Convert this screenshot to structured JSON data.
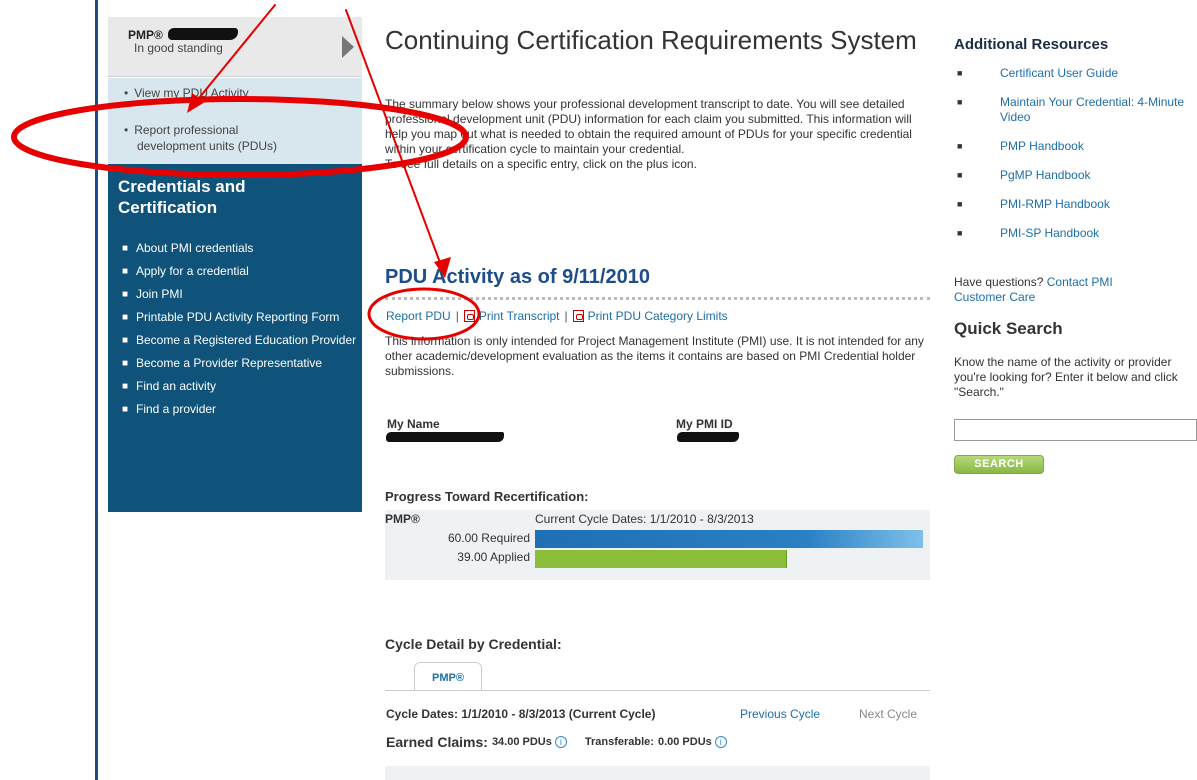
{
  "sidebar": {
    "credential": "PMP®",
    "status": "In good standing",
    "links": [
      {
        "label": "View my PDU Activity"
      },
      {
        "label_line1": "Report professional",
        "label_line2": "development units (PDUs)"
      }
    ],
    "section_title": "Credentials and Certification",
    "items": [
      {
        "label": "About PMI credentials"
      },
      {
        "label": "Apply for a credential"
      },
      {
        "label": "Join PMI"
      },
      {
        "label": "Printable PDU Activity Reporting Form"
      },
      {
        "label": "Become a Registered Education Provider"
      },
      {
        "label": "Become a Provider Representative"
      },
      {
        "label": "Find an activity"
      },
      {
        "label": "Find a provider"
      }
    ]
  },
  "main": {
    "title": "Continuing Certification Requirements System",
    "intro": "The summary below shows your professional development transcript to date. You will see detailed professional development unit (PDU) information for each claim you submitted. This information will help you map out what is needed to obtain the required amount of PDUs for your specific credential within your certification cycle to maintain your credential.",
    "intro_2": "To see full details on a specific entry, click on the plus icon.",
    "pdu_heading": "PDU Activity as of 9/11/2010",
    "actions": {
      "report": "Report PDU",
      "print_transcript": "Print Transcript",
      "print_limits": "Print PDU Category Limits",
      "separator": "|"
    },
    "note": "This information is only intended for Project Management Institute (PMI) use. It is not intended for any other academic/development evaluation as the items it contains are based on PMI Credential holder submissions.",
    "my_name_label": "My Name",
    "my_id_label": "My PMI ID",
    "progress": {
      "title": "Progress Toward Recertification:",
      "credential": "PMP®",
      "cycle_dates": "Current Cycle Dates: 1/1/2010 - 8/3/2013",
      "required_label": "60.00 Required",
      "applied_label": "39.00 Applied",
      "required_value": 60,
      "applied_value": 39,
      "max_value": 60
    },
    "cycle": {
      "title": "Cycle Detail by Credential:",
      "tab": "PMP®",
      "dates": "Cycle Dates: 1/1/2010 - 8/3/2013 (Current Cycle)",
      "previous": "Previous Cycle",
      "next": "Next Cycle",
      "earned_label": "Earned Claims:",
      "earned_value": "34.00 PDUs",
      "transferable_label": "Transferable:",
      "transferable_value": "0.00 PDUs",
      "info_glyph": "i"
    }
  },
  "right": {
    "heading": "Additional Resources",
    "bullet": "■",
    "resources": [
      {
        "label": "Certificant User Guide"
      },
      {
        "label": "Maintain Your Credential: 4-Minute Video"
      },
      {
        "label": "PMP Handbook"
      },
      {
        "label": "PgMP Handbook"
      },
      {
        "label": "PMI-RMP Handbook"
      },
      {
        "label": "PMI-SP Handbook"
      }
    ],
    "questions_text": "Have questions?",
    "questions_link": "Contact PMI Customer Care",
    "quick_search": {
      "heading": "Quick Search",
      "description": "Know the name of the activity or provider you're looking for? Enter it below and click \"Search.\"",
      "value": "",
      "button": "SEARCH"
    }
  },
  "colors": {
    "accent": "#1d4e89",
    "sidebar_dark": "#0f527a",
    "required_bar": "#1f6fb5",
    "applied_bar": "#8cbd38",
    "annotation": "#e60000"
  }
}
